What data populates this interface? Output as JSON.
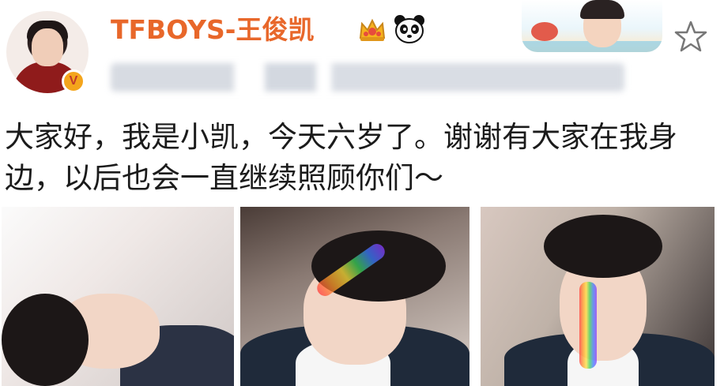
{
  "user": {
    "name": "TFBOYS-王俊凯",
    "verified_badge": "V",
    "crown_icon": "crown-icon",
    "panda_icon": "panda-icon",
    "accent_color": "#e8672a"
  },
  "actions": {
    "favorite_icon": "star-icon"
  },
  "post": {
    "text": "大家好，我是小凯，今天六岁了。谢谢有大家在我身边，以后也会一直继续照顾你们～"
  },
  "photos": [
    {
      "name": "photo-1"
    },
    {
      "name": "photo-2"
    },
    {
      "name": "photo-3"
    }
  ]
}
